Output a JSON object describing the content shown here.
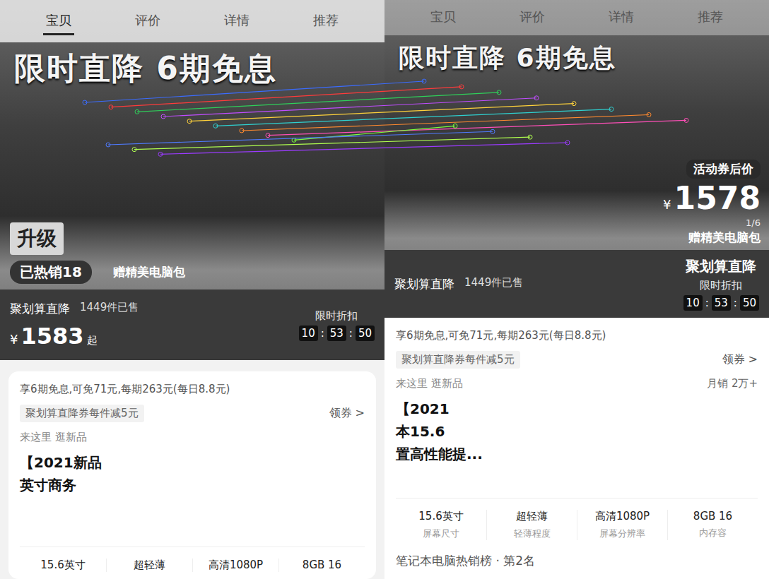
{
  "screen_a": {
    "tabs": [
      {
        "label": "宝贝",
        "selected": true
      },
      {
        "label": "评价",
        "selected": false
      },
      {
        "label": "详情",
        "selected": false
      },
      {
        "label": "推荐",
        "selected": false
      }
    ],
    "banner": "限时直降 6期免息",
    "promo_title": "升级",
    "sold_badge": "已热销18",
    "gift": "赠精美电脑包",
    "deal_name": "聚划算直降",
    "sold": "1449件已售",
    "currency": "¥",
    "price": "1583",
    "price_suffix": "起",
    "discount": "限时折扣",
    "countdown": [
      "10",
      "53",
      "50"
    ],
    "installment": "享6期免息,可免71元,每期263元(每日8.8元)",
    "coupon": "聚划算直降券每件减5元",
    "coupon_action": "领券 >",
    "new_link": "来这里 逛新品",
    "title_lines": [
      "【2021新品",
      "英寸商务"
    ],
    "specs": [
      "15.6英寸",
      "超轻薄",
      "高清1080P",
      "8GB 16"
    ]
  },
  "screen_b": {
    "tabs": [
      {
        "label": "宝贝",
        "selected": false
      },
      {
        "label": "评价",
        "selected": false
      },
      {
        "label": "详情",
        "selected": false
      },
      {
        "label": "推荐",
        "selected": false
      }
    ],
    "banner": "限时直降 6期免息",
    "price_label": "活动券后价",
    "currency": "¥",
    "price": "1578",
    "gallery_index": "1/6",
    "gift": "赠精美电脑包",
    "deal_name": "聚划算直降",
    "sold": "1449件已售",
    "deal_tag": "聚划算直降",
    "discount": "限时折扣",
    "countdown": [
      "10",
      "53",
      "50"
    ],
    "installment": "享6期免息,可免71元,每期263元(每日8.8元)",
    "coupon": "聚划算直降券每件减5元",
    "coupon_action": "领券 >",
    "new_link": "来这里 逛新品",
    "monthly": "月销 2万+",
    "title_lines": [
      "【2021",
      "本15.6",
      "置高性能提..."
    ],
    "specs": [
      {
        "value": "15.6英寸",
        "label": "屏幕尺寸"
      },
      {
        "value": "超轻薄",
        "label": "轻薄程度"
      },
      {
        "value": "高清1080P",
        "label": "屏幕分辨率"
      },
      {
        "value": "8GB 16",
        "label": "内存容"
      }
    ],
    "ranking": "笔记本电脑热销榜 · 第2名"
  },
  "match_lines": [
    {
      "color": "#3b6cff"
    },
    {
      "color": "#ff3b3b"
    },
    {
      "color": "#2fd05a"
    },
    {
      "color": "#c04dff"
    },
    {
      "color": "#ffd23b"
    },
    {
      "color": "#2fd0d0"
    },
    {
      "color": "#ff8a2f"
    },
    {
      "color": "#ff4fb8"
    },
    {
      "color": "#7bff3b"
    },
    {
      "color": "#4f7bff"
    },
    {
      "color": "#b0ff4f"
    },
    {
      "color": "#9b3bff"
    }
  ]
}
